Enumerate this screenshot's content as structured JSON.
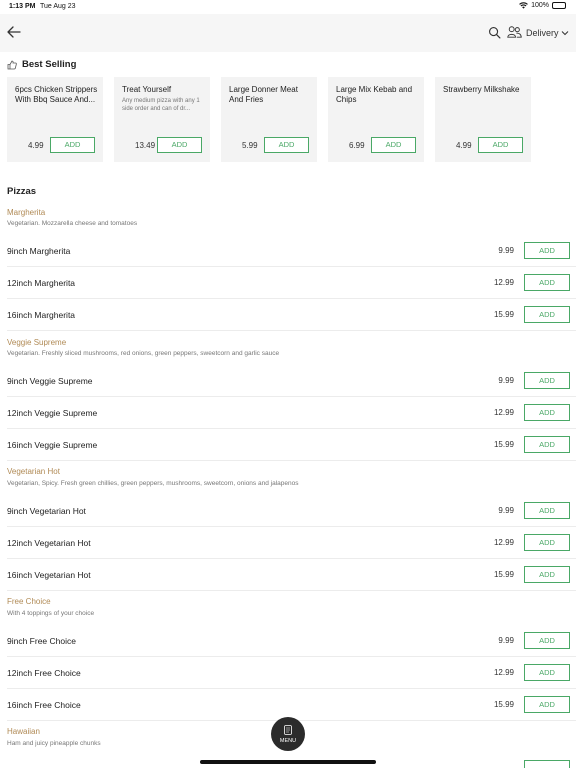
{
  "status": {
    "time": "1:13 PM",
    "date": "Tue Aug 23",
    "battery": "100%"
  },
  "nav": {
    "back_icon": "back-arrow-icon",
    "search_icon": "search-icon",
    "people_icon": "people-icon",
    "mode": "Delivery",
    "chevron_icon": "chevron-down-icon"
  },
  "best_selling": {
    "label": "Best Selling",
    "icon": "thumbs-up-icon",
    "cards": [
      {
        "name": "6pcs Chicken Strippers With Bbq Sauce And...",
        "desc": "",
        "price": "4.99",
        "add": "ADD"
      },
      {
        "name": "Treat Yourself",
        "desc": "Any medium pizza with any 1 side order and can of dr...",
        "price": "13.49",
        "add": "ADD"
      },
      {
        "name": "Large Donner Meat And Fries",
        "desc": "",
        "price": "5.99",
        "add": "ADD"
      },
      {
        "name": "Large Mix Kebab and Chips",
        "desc": "",
        "price": "6.99",
        "add": "ADD"
      },
      {
        "name": "Strawberry Milkshake",
        "desc": "",
        "price": "4.99",
        "add": "ADD"
      }
    ]
  },
  "pizzas": {
    "title": "Pizzas",
    "groups": [
      {
        "name": "Margherita",
        "desc": "Vegetarian. Mozzarella cheese and tomatoes",
        "items": [
          {
            "name": "9inch Margherita",
            "price": "9.99",
            "add": "ADD"
          },
          {
            "name": "12inch Margherita",
            "price": "12.99",
            "add": "ADD"
          },
          {
            "name": "16inch Margherita",
            "price": "15.99",
            "add": "ADD"
          }
        ]
      },
      {
        "name": "Veggie Supreme",
        "desc": "Vegetarian. Freshly sliced mushrooms, red onions, green peppers, sweetcorn and garlic sauce",
        "items": [
          {
            "name": "9inch Veggie Supreme",
            "price": "9.99",
            "add": "ADD"
          },
          {
            "name": "12inch Veggie Supreme",
            "price": "12.99",
            "add": "ADD"
          },
          {
            "name": "16inch Veggie Supreme",
            "price": "15.99",
            "add": "ADD"
          }
        ]
      },
      {
        "name": "Vegetarian Hot",
        "desc": "Vegetarian, Spicy. Fresh green chillies, green peppers, mushrooms, sweetcorn, onions and jalapenos",
        "items": [
          {
            "name": "9inch Vegetarian Hot",
            "price": "9.99",
            "add": "ADD"
          },
          {
            "name": "12inch Vegetarian Hot",
            "price": "12.99",
            "add": "ADD"
          },
          {
            "name": "16inch Vegetarian Hot",
            "price": "15.99",
            "add": "ADD"
          }
        ]
      },
      {
        "name": "Free Choice",
        "desc": "With 4 toppings of your choice",
        "items": [
          {
            "name": "9inch Free Choice",
            "price": "9.99",
            "add": "ADD"
          },
          {
            "name": "12inch Free Choice",
            "price": "12.99",
            "add": "ADD"
          },
          {
            "name": "16inch Free Choice",
            "price": "15.99",
            "add": "ADD"
          }
        ]
      },
      {
        "name": "Hawaiian",
        "desc": "Ham and juicy pineapple chunks",
        "items": []
      }
    ]
  },
  "menu_button": {
    "label": "MENU",
    "icon": "menu-book-icon"
  },
  "colors": {
    "accent": "#4aa866",
    "group_name": "#b08a55"
  }
}
